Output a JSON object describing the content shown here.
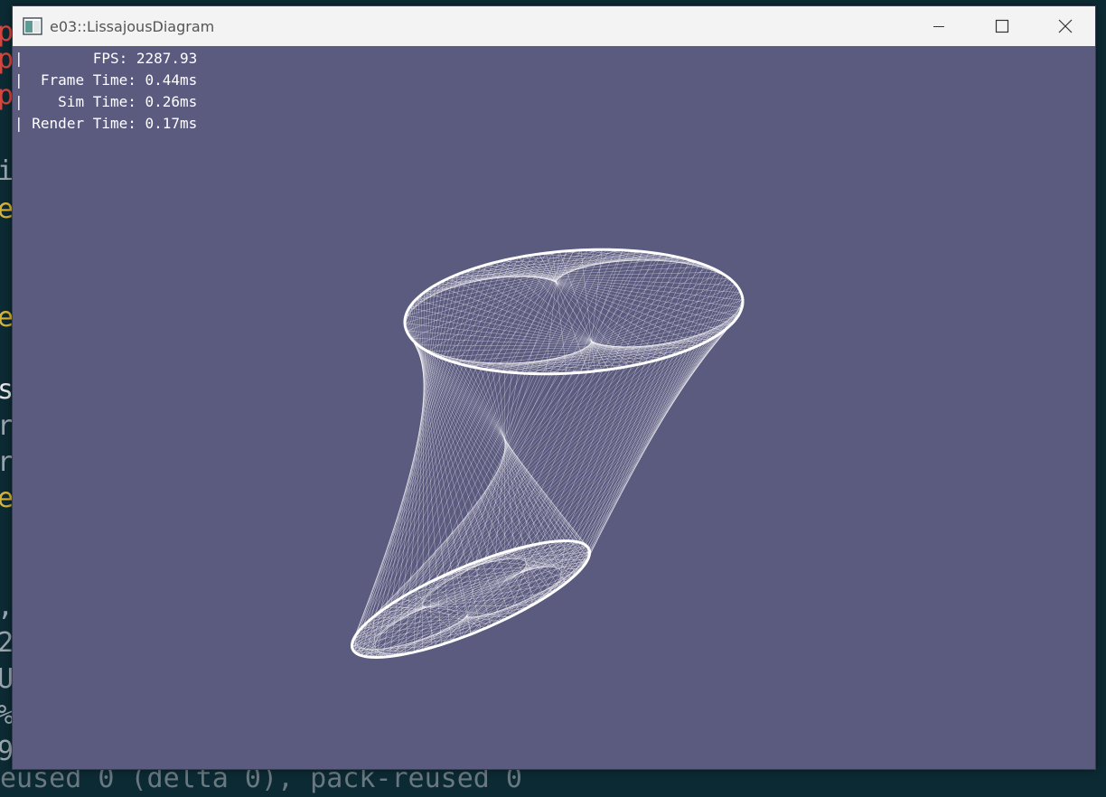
{
  "window": {
    "title": "e03::LissajousDiagram",
    "icons": {
      "app": "app-window-icon",
      "minimize": "minimize-icon",
      "maximize": "maximize-icon",
      "close": "close-icon"
    }
  },
  "stats": {
    "prefix": "|",
    "fps_label": "FPS:",
    "fps_value": "2287.93",
    "frame_label": "Frame Time:",
    "frame_value": "0.44ms",
    "sim_label": "Sim Time:",
    "sim_value": "0.26ms",
    "render_label": "Render Time:",
    "render_value": "0.17ms"
  },
  "background_editor": {
    "left_chars": [
      "p",
      "p",
      "p",
      "i",
      "e",
      "e",
      "s",
      "r",
      "r",
      "e",
      ",",
      "2",
      "U",
      "%",
      "9"
    ],
    "bottom_text": "eused 0 (delta 0), pack-reused 0"
  },
  "colors": {
    "viewport_bg": "#5b5a7f",
    "line_color": "#ffffff",
    "titlebar_bg": "#f3f3f3"
  }
}
